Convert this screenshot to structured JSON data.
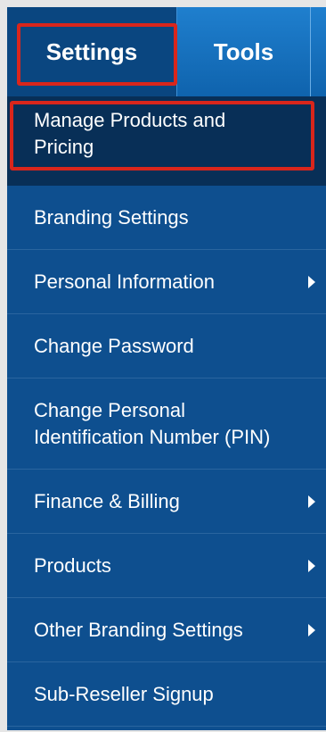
{
  "tabs": {
    "settings": "Settings",
    "tools": "Tools"
  },
  "menu": [
    {
      "label": "Manage Products and Pricing",
      "submenu": false,
      "active": true
    },
    {
      "label": "Branding Settings",
      "submenu": false
    },
    {
      "label": "Personal Information",
      "submenu": true
    },
    {
      "label": "Change Password",
      "submenu": false
    },
    {
      "label": "Change Personal Identification Number (PIN)",
      "submenu": false
    },
    {
      "label": "Finance & Billing",
      "submenu": true
    },
    {
      "label": "Products",
      "submenu": true
    },
    {
      "label": "Other Branding Settings",
      "submenu": true
    },
    {
      "label": "Sub-Reseller Signup",
      "submenu": false
    }
  ],
  "colors": {
    "panel": "#0e4f8f",
    "active_item": "#082f57",
    "highlight": "#d9261c",
    "tab_inactive": "#1f7fce"
  }
}
